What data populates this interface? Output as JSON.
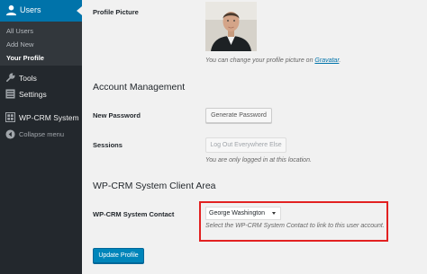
{
  "sidebar": {
    "active_menu": "Users",
    "submenu": [
      "All Users",
      "Add New",
      "Your Profile"
    ],
    "current_submenu": "Your Profile",
    "tools": "Tools",
    "settings": "Settings",
    "wpcrm": "WP-CRM System",
    "collapse": "Collapse menu"
  },
  "profile_picture": {
    "label": "Profile Picture",
    "hint_prefix": "You can change your profile picture on ",
    "hint_link": "Gravatar",
    "hint_suffix": "."
  },
  "account_management": {
    "heading": "Account Management",
    "new_password_label": "New Password",
    "generate_button": "Generate Password",
    "sessions_label": "Sessions",
    "logout_button": "Log Out Everywhere Else",
    "sessions_hint": "You are only logged in at this location."
  },
  "crm_area": {
    "heading": "WP-CRM System Client Area",
    "contact_label": "WP-CRM System Contact",
    "selected_contact": "George Washington",
    "contact_hint": "Select the WP-CRM System Contact to link to this user account."
  },
  "update_button": "Update Profile",
  "colors": {
    "sidebar_bg": "#23282d",
    "active_menu_bg": "#0073aa",
    "primary_button": "#0085ba",
    "highlight_border": "#e22121"
  }
}
